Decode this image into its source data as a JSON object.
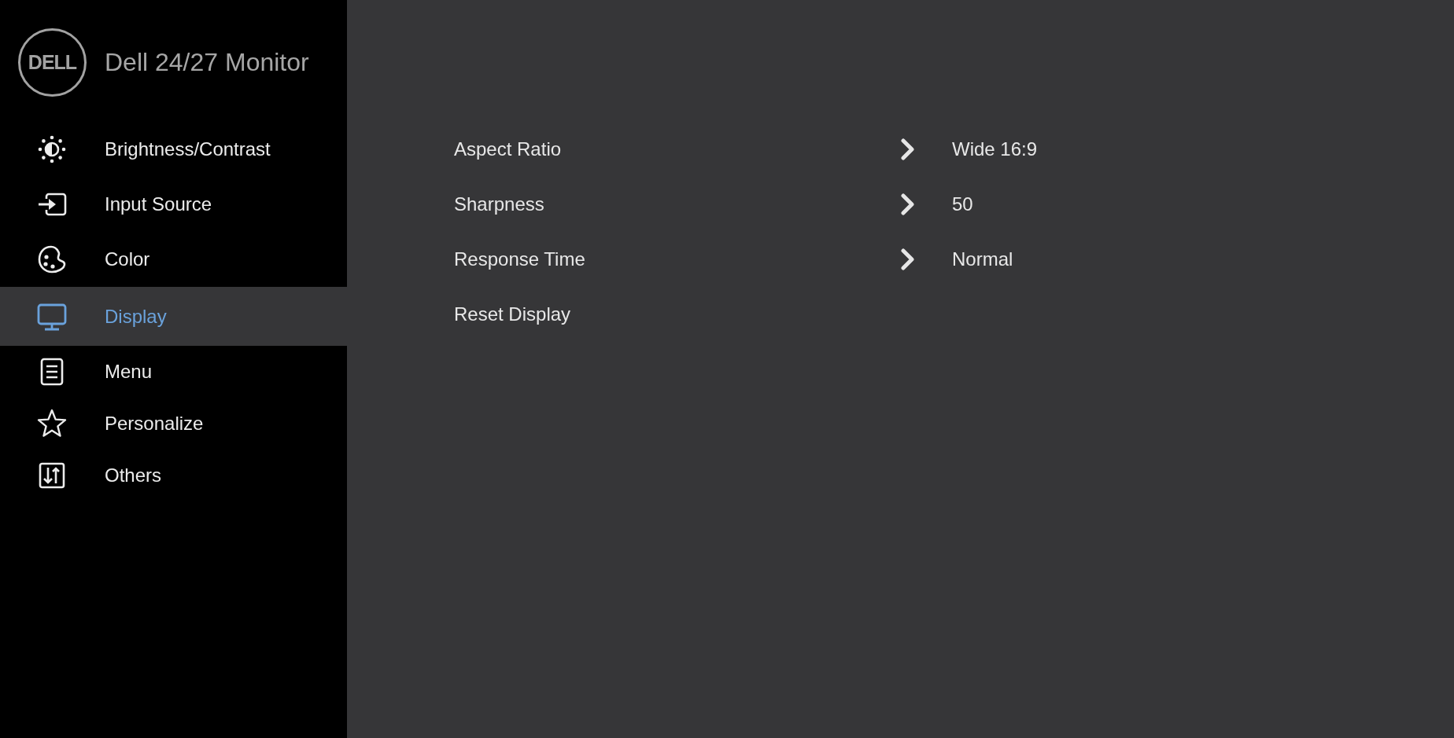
{
  "header": {
    "logo": "DELL",
    "title": "Dell 24/27 Monitor"
  },
  "sidebar": {
    "items": [
      {
        "label": "Brightness/Contrast",
        "selected": false
      },
      {
        "label": "Input Source",
        "selected": false
      },
      {
        "label": "Color",
        "selected": false
      },
      {
        "label": "Display",
        "selected": true
      },
      {
        "label": "Menu",
        "selected": false
      },
      {
        "label": "Personalize",
        "selected": false
      },
      {
        "label": "Others",
        "selected": false
      }
    ]
  },
  "settings": {
    "rows": [
      {
        "kind": "option",
        "label": "Aspect Ratio",
        "value": "Wide 16:9"
      },
      {
        "kind": "option",
        "label": "Sharpness",
        "value": "50"
      },
      {
        "kind": "option",
        "label": "Response Time",
        "value": "Normal"
      },
      {
        "kind": "action",
        "label": "Reset Display"
      }
    ]
  }
}
